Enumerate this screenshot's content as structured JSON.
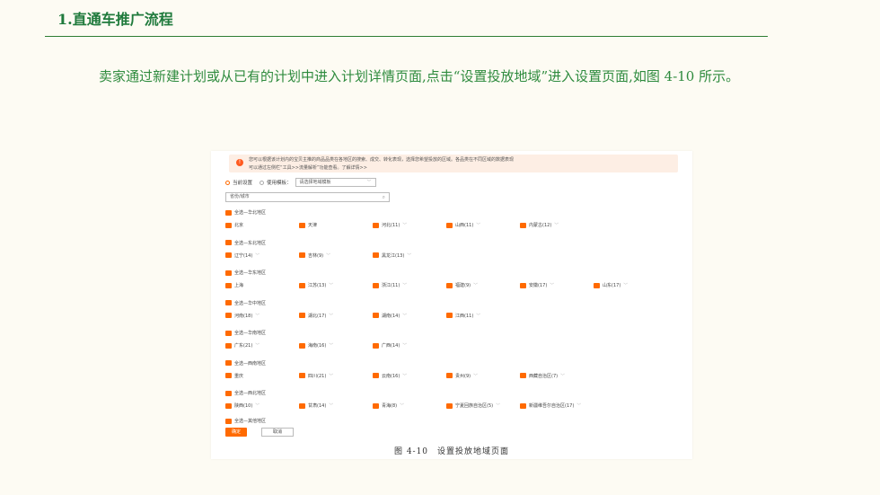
{
  "slide": {
    "title": "1.直通车推广流程",
    "paragraph": "卖家通过新建计划或从已有的计划中进入计划详情页面,点击“设置投放地域”进入设置页面,如图 4-10 所示。"
  },
  "figure": {
    "notice_line1": "您可以根据该计划内的宝贝主推的商品品类在各地区的搜索、成交、转化表现，选择您希望投放的区域。各品类在不同区域的数据表现",
    "notice_line2": "可以通过左侧栏“工具>>流量解析”功能查看。了解详情>>",
    "radio_current": "当前设置",
    "radio_template": "使用模板：",
    "template_select": "请选择地域模板",
    "search_placeholder": "省份/城市",
    "groups": [
      {
        "label": "全选—华北地区",
        "provinces": [
          "北京",
          "天津",
          "河北(11)",
          "山西(11)",
          "内蒙古(12)"
        ]
      },
      {
        "label": "全选—东北地区",
        "provinces": [
          "辽宁(14)",
          "吉林(9)",
          "黑龙江(13)"
        ]
      },
      {
        "label": "全选—华东地区",
        "provinces": [
          "上海",
          "江苏(13)",
          "浙江(11)",
          "福建(9)",
          "安徽(17)",
          "山东(17)"
        ]
      },
      {
        "label": "全选—华中地区",
        "provinces": [
          "河南(18)",
          "湖北(17)",
          "湖南(14)",
          "江西(11)"
        ]
      },
      {
        "label": "全选—华南地区",
        "provinces": [
          "广东(21)",
          "海南(16)",
          "广西(14)"
        ]
      },
      {
        "label": "全选—西南地区",
        "provinces": [
          "重庆",
          "四川(21)",
          "云南(16)",
          "贵州(9)",
          "西藏自治区(7)"
        ]
      },
      {
        "label": "全选—西北地区",
        "provinces": [
          "陕西(10)",
          "甘肃(14)",
          "青海(8)",
          "宁夏回族自治区(5)",
          "新疆维吾尔自治区(17)"
        ]
      }
    ],
    "other_group": "全选—其他地区",
    "ok_button": "确定",
    "cancel_button": "取消",
    "caption": "图 4-10　设置投放地域页面"
  },
  "colors": {
    "accent": "#ff6a00",
    "title_green": "#1f7a3c",
    "text_green": "#2e8b3e"
  }
}
